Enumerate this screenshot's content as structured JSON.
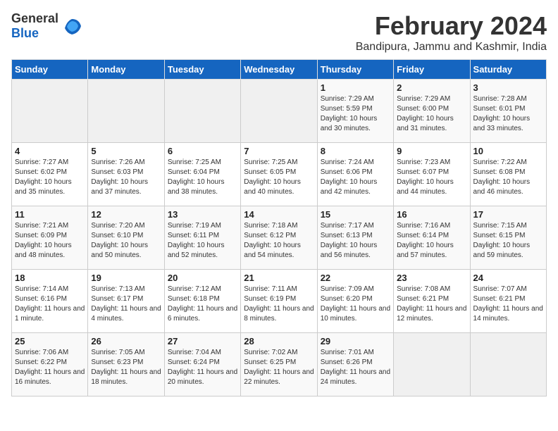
{
  "header": {
    "logo_general": "General",
    "logo_blue": "Blue",
    "month": "February 2024",
    "location": "Bandipura, Jammu and Kashmir, India"
  },
  "days_of_week": [
    "Sunday",
    "Monday",
    "Tuesday",
    "Wednesday",
    "Thursday",
    "Friday",
    "Saturday"
  ],
  "weeks": [
    [
      {
        "day": "",
        "empty": true
      },
      {
        "day": "",
        "empty": true
      },
      {
        "day": "",
        "empty": true
      },
      {
        "day": "",
        "empty": true
      },
      {
        "day": "1",
        "sunrise": "7:29 AM",
        "sunset": "5:59 PM",
        "daylight": "10 hours and 30 minutes."
      },
      {
        "day": "2",
        "sunrise": "7:29 AM",
        "sunset": "6:00 PM",
        "daylight": "10 hours and 31 minutes."
      },
      {
        "day": "3",
        "sunrise": "7:28 AM",
        "sunset": "6:01 PM",
        "daylight": "10 hours and 33 minutes."
      }
    ],
    [
      {
        "day": "4",
        "sunrise": "7:27 AM",
        "sunset": "6:02 PM",
        "daylight": "10 hours and 35 minutes."
      },
      {
        "day": "5",
        "sunrise": "7:26 AM",
        "sunset": "6:03 PM",
        "daylight": "10 hours and 37 minutes."
      },
      {
        "day": "6",
        "sunrise": "7:25 AM",
        "sunset": "6:04 PM",
        "daylight": "10 hours and 38 minutes."
      },
      {
        "day": "7",
        "sunrise": "7:25 AM",
        "sunset": "6:05 PM",
        "daylight": "10 hours and 40 minutes."
      },
      {
        "day": "8",
        "sunrise": "7:24 AM",
        "sunset": "6:06 PM",
        "daylight": "10 hours and 42 minutes."
      },
      {
        "day": "9",
        "sunrise": "7:23 AM",
        "sunset": "6:07 PM",
        "daylight": "10 hours and 44 minutes."
      },
      {
        "day": "10",
        "sunrise": "7:22 AM",
        "sunset": "6:08 PM",
        "daylight": "10 hours and 46 minutes."
      }
    ],
    [
      {
        "day": "11",
        "sunrise": "7:21 AM",
        "sunset": "6:09 PM",
        "daylight": "10 hours and 48 minutes."
      },
      {
        "day": "12",
        "sunrise": "7:20 AM",
        "sunset": "6:10 PM",
        "daylight": "10 hours and 50 minutes."
      },
      {
        "day": "13",
        "sunrise": "7:19 AM",
        "sunset": "6:11 PM",
        "daylight": "10 hours and 52 minutes."
      },
      {
        "day": "14",
        "sunrise": "7:18 AM",
        "sunset": "6:12 PM",
        "daylight": "10 hours and 54 minutes."
      },
      {
        "day": "15",
        "sunrise": "7:17 AM",
        "sunset": "6:13 PM",
        "daylight": "10 hours and 56 minutes."
      },
      {
        "day": "16",
        "sunrise": "7:16 AM",
        "sunset": "6:14 PM",
        "daylight": "10 hours and 57 minutes."
      },
      {
        "day": "17",
        "sunrise": "7:15 AM",
        "sunset": "6:15 PM",
        "daylight": "10 hours and 59 minutes."
      }
    ],
    [
      {
        "day": "18",
        "sunrise": "7:14 AM",
        "sunset": "6:16 PM",
        "daylight": "11 hours and 1 minute."
      },
      {
        "day": "19",
        "sunrise": "7:13 AM",
        "sunset": "6:17 PM",
        "daylight": "11 hours and 4 minutes."
      },
      {
        "day": "20",
        "sunrise": "7:12 AM",
        "sunset": "6:18 PM",
        "daylight": "11 hours and 6 minutes."
      },
      {
        "day": "21",
        "sunrise": "7:11 AM",
        "sunset": "6:19 PM",
        "daylight": "11 hours and 8 minutes."
      },
      {
        "day": "22",
        "sunrise": "7:09 AM",
        "sunset": "6:20 PM",
        "daylight": "11 hours and 10 minutes."
      },
      {
        "day": "23",
        "sunrise": "7:08 AM",
        "sunset": "6:21 PM",
        "daylight": "11 hours and 12 minutes."
      },
      {
        "day": "24",
        "sunrise": "7:07 AM",
        "sunset": "6:21 PM",
        "daylight": "11 hours and 14 minutes."
      }
    ],
    [
      {
        "day": "25",
        "sunrise": "7:06 AM",
        "sunset": "6:22 PM",
        "daylight": "11 hours and 16 minutes."
      },
      {
        "day": "26",
        "sunrise": "7:05 AM",
        "sunset": "6:23 PM",
        "daylight": "11 hours and 18 minutes."
      },
      {
        "day": "27",
        "sunrise": "7:04 AM",
        "sunset": "6:24 PM",
        "daylight": "11 hours and 20 minutes."
      },
      {
        "day": "28",
        "sunrise": "7:02 AM",
        "sunset": "6:25 PM",
        "daylight": "11 hours and 22 minutes."
      },
      {
        "day": "29",
        "sunrise": "7:01 AM",
        "sunset": "6:26 PM",
        "daylight": "11 hours and 24 minutes."
      },
      {
        "day": "",
        "empty": true
      },
      {
        "day": "",
        "empty": true
      }
    ]
  ],
  "labels": {
    "sunrise_prefix": "Sunrise: ",
    "sunset_prefix": "Sunset: ",
    "daylight_prefix": "Daylight: "
  }
}
